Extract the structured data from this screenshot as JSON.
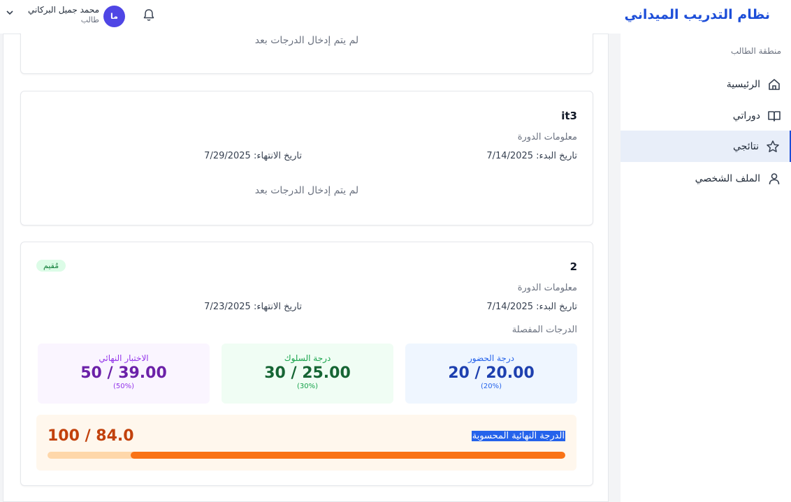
{
  "header": {
    "app_title": "نظام التدريب الميداني",
    "user_name": "محمد جميل البركاني",
    "user_role": "طالب",
    "avatar_initials": "ما"
  },
  "sidebar": {
    "section_label": "منطقة الطالب",
    "items": [
      {
        "label": "الرئيسية",
        "icon": "home-icon",
        "active": false
      },
      {
        "label": "دوراتي",
        "icon": "book-icon",
        "active": false
      },
      {
        "label": "نتائجي",
        "icon": "star-icon",
        "active": true
      },
      {
        "label": "الملف الشخصي",
        "icon": "user-icon",
        "active": false
      }
    ]
  },
  "courses": [
    {
      "no_grades": "لم يتم إدخال الدرجات بعد"
    },
    {
      "title": "it3",
      "info_label": "معلومات الدورة",
      "start_date": "تاريخ البدء: 7/14/2025",
      "end_date": "تاريخ الانتهاء: 7/29/2025",
      "no_grades": "لم يتم إدخال الدرجات بعد"
    },
    {
      "title": "2",
      "status_badge": "مُقيم",
      "info_label": "معلومات الدورة",
      "start_date": "تاريخ البدء: 7/14/2025",
      "end_date": "تاريخ الانتهاء: 7/23/2025",
      "detailed_label": "الدرجات المفصلة",
      "grades": {
        "attendance": {
          "label": "درجة الحضور",
          "value": "20 / 20.00",
          "percent": "(20%)"
        },
        "behavior": {
          "label": "درجة السلوك",
          "value": "30 / 25.00",
          "percent": "(30%)"
        },
        "final_exam": {
          "label": "الاختبار النهائي",
          "value": "50 / 39.00",
          "percent": "(50%)"
        }
      },
      "final": {
        "label": "الدرجة النهائية المحسوبة",
        "value": "100 / 84.0",
        "progress": 0.84
      }
    }
  ],
  "colors": {
    "brand": "#1d4ed8",
    "attendance": "#1e40af",
    "behavior": "#166534",
    "final_exam": "#6b21a8",
    "final_total": "#c2410c",
    "progress": "#f97316"
  }
}
